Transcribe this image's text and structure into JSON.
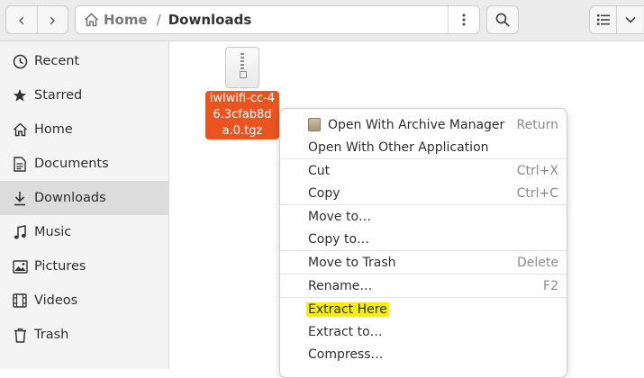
{
  "header": {
    "back_glyph": "‹",
    "forward_glyph": "›",
    "breadcrumb": {
      "home": "Home",
      "separator": "/",
      "current": "Downloads"
    }
  },
  "sidebar": {
    "items": [
      {
        "label": "Recent",
        "icon": "clock-icon",
        "active": false
      },
      {
        "label": "Starred",
        "icon": "star-icon",
        "active": false
      },
      {
        "label": "Home",
        "icon": "home-icon",
        "active": false
      },
      {
        "label": "Documents",
        "icon": "document-icon",
        "active": false
      },
      {
        "label": "Downloads",
        "icon": "download-icon",
        "active": true
      },
      {
        "label": "Music",
        "icon": "music-icon",
        "active": false
      },
      {
        "label": "Pictures",
        "icon": "picture-icon",
        "active": false
      },
      {
        "label": "Videos",
        "icon": "video-icon",
        "active": false
      },
      {
        "label": "Trash",
        "icon": "trash-icon",
        "active": false
      }
    ]
  },
  "file": {
    "name": "iwlwifi-cc-46.3cfab8da.0.tgz",
    "selected": true
  },
  "context_menu": {
    "items": [
      {
        "label": "Open With Archive Manager",
        "accel": "Return"
      },
      {
        "label": "Open With Other Application",
        "accel": ""
      },
      {
        "label": "Cut",
        "accel": "Ctrl+X"
      },
      {
        "label": "Copy",
        "accel": "Ctrl+C"
      },
      {
        "label": "Move to…",
        "accel": ""
      },
      {
        "label": "Copy to…",
        "accel": ""
      },
      {
        "label": "Move to Trash",
        "accel": "Delete"
      },
      {
        "label": "Rename…",
        "accel": "F2"
      },
      {
        "label": "Extract Here",
        "accel": ""
      },
      {
        "label": "Extract to…",
        "accel": ""
      },
      {
        "label": "Compress…",
        "accel": ""
      }
    ]
  },
  "colors": {
    "accent": "#e95420",
    "highlight": "#f7ef00",
    "sidebar_active": "#dcdcdc"
  }
}
